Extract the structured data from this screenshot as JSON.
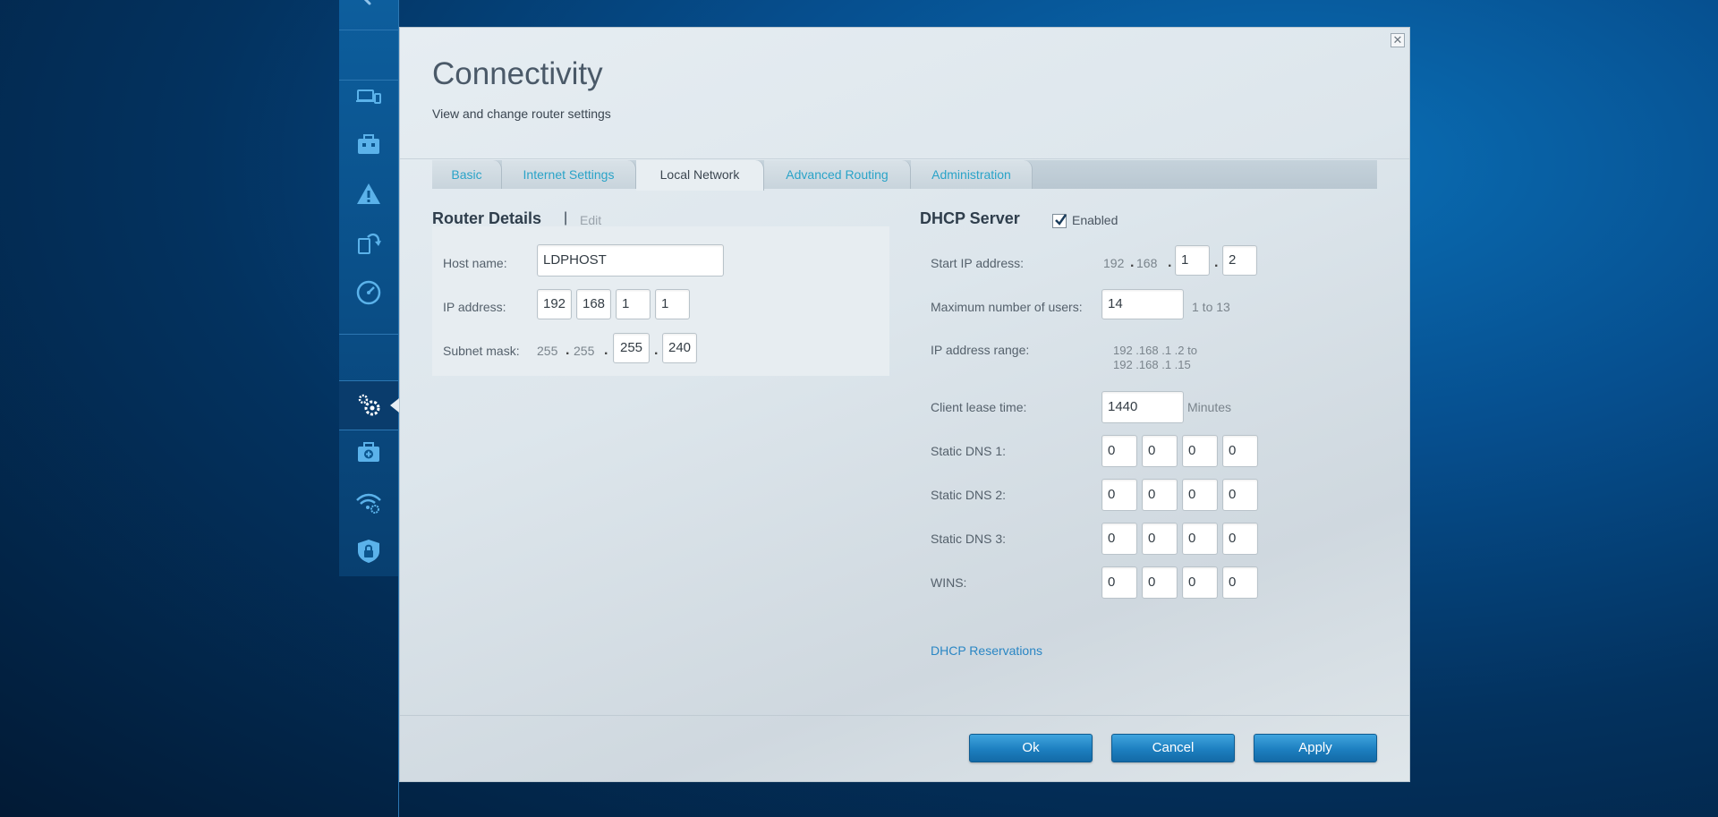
{
  "sidebar": {
    "items": [
      {
        "icon": "devices-icon",
        "name": "sidebar-item-devices"
      },
      {
        "icon": "toolbox-icon",
        "name": "sidebar-item-parental"
      },
      {
        "icon": "warning-icon",
        "name": "sidebar-item-alerts"
      },
      {
        "icon": "update-icon",
        "name": "sidebar-item-updates"
      },
      {
        "icon": "speedometer-icon",
        "name": "sidebar-item-speed"
      },
      {
        "icon": "gears-icon",
        "name": "sidebar-item-connectivity"
      },
      {
        "icon": "medkit-icon",
        "name": "sidebar-item-troubleshooting"
      },
      {
        "icon": "wifi-settings-icon",
        "name": "sidebar-item-wireless"
      },
      {
        "icon": "shield-lock-icon",
        "name": "sidebar-item-security"
      }
    ]
  },
  "dialog": {
    "title": "Connectivity",
    "subtitle": "View and change router settings",
    "close_glyph": "✕"
  },
  "tabs": [
    {
      "label": "Basic"
    },
    {
      "label": "Internet Settings"
    },
    {
      "label": "Local Network"
    },
    {
      "label": "Advanced Routing"
    },
    {
      "label": "Administration"
    }
  ],
  "active_tab": "Local Network",
  "router_details": {
    "title": "Router Details",
    "separator": "|",
    "edit_label": "Edit",
    "host_name_label": "Host name:",
    "host_name_value": "LDPHOST",
    "ip_label": "IP address:",
    "ip": [
      "192",
      "168",
      "1",
      "1"
    ],
    "subnet_label": "Subnet mask:",
    "subnet_static": [
      "255",
      "255"
    ],
    "subnet_inputs": [
      "255",
      "240"
    ],
    "dot": "."
  },
  "dhcp": {
    "title": "DHCP Server",
    "enabled_label": "Enabled",
    "enabled": true,
    "start_ip_label": "Start IP address:",
    "start_ip_static": [
      "192",
      "168"
    ],
    "start_ip_inputs": [
      "1",
      "2"
    ],
    "max_users_label": "Maximum number of users:",
    "max_users_value": "14",
    "max_users_hint": "1 to 13",
    "range_label": "IP address range:",
    "range_line1": "192 .168 .1 .2  to",
    "range_line2": "192 .168 .1 .15",
    "lease_label": "Client lease time:",
    "lease_value": "1440",
    "lease_unit": "Minutes",
    "dns1_label": "Static DNS 1:",
    "dns1": [
      "0",
      "0",
      "0",
      "0"
    ],
    "dns2_label": "Static DNS 2:",
    "dns2": [
      "0",
      "0",
      "0",
      "0"
    ],
    "dns3_label": "Static DNS 3:",
    "dns3": [
      "0",
      "0",
      "0",
      "0"
    ],
    "wins_label": "WINS:",
    "wins": [
      "0",
      "0",
      "0",
      "0"
    ],
    "reservations_link": "DHCP Reservations"
  },
  "footer": {
    "ok_label": "Ok",
    "cancel_label": "Cancel",
    "apply_label": "Apply"
  },
  "colors": {
    "accent": "#2aa3c8",
    "button": "#1d7fc0",
    "link": "#2a86c4"
  }
}
